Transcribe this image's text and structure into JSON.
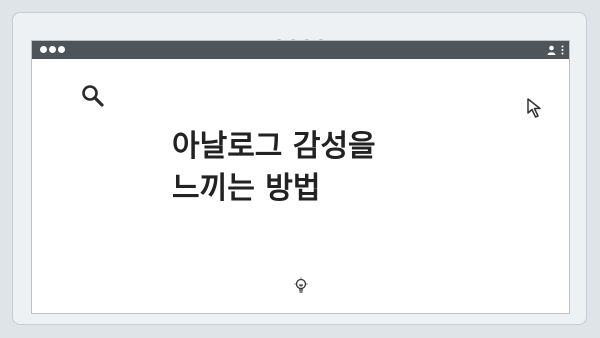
{
  "carousel": {
    "dot_count": 4
  },
  "browser": {
    "window_controls": [
      "window-dot",
      "window-dot",
      "window-dot"
    ],
    "toolbar_icons": [
      "account-icon",
      "more-options-icon"
    ]
  },
  "illustration": {
    "headline_line1": "아날로그 감성을",
    "headline_line2": "느끼는 방법",
    "icons": [
      "search-icon",
      "cursor-arrow-icon",
      "lightbulb-icon"
    ]
  },
  "colors": {
    "background": "#dfe4e8",
    "title_bar": "#4f5458",
    "text": "#222222",
    "window": "#ffffff"
  }
}
